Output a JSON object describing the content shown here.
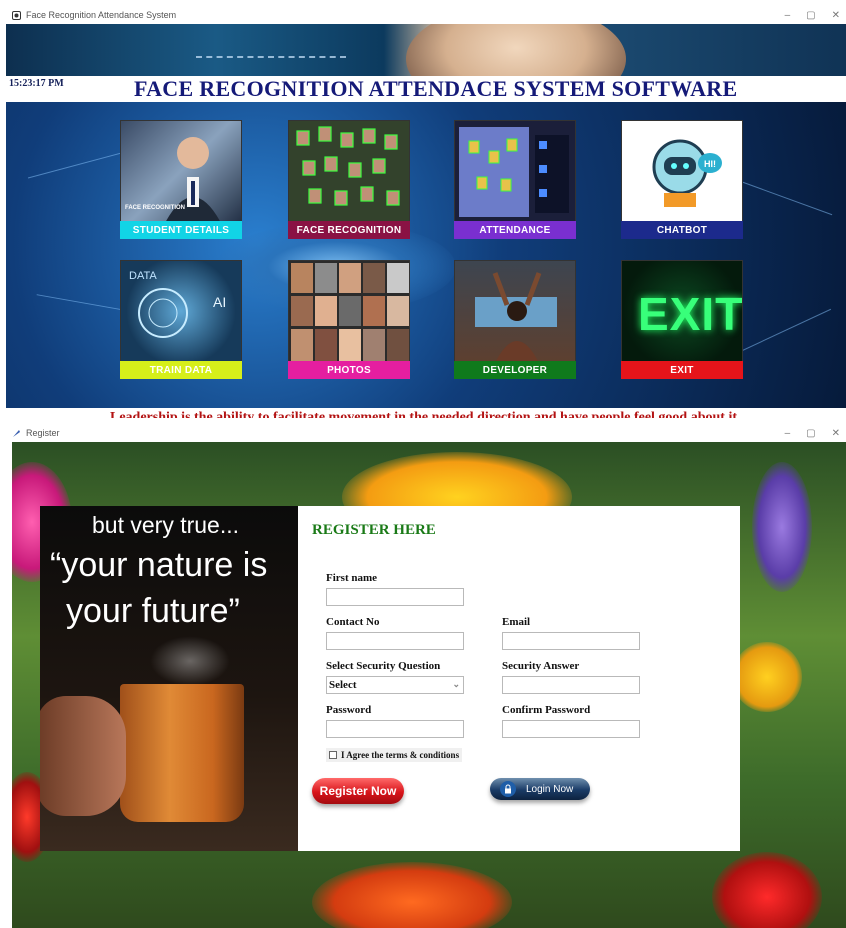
{
  "window1": {
    "title": "Face Recognition Attendance System",
    "clock": "15:23:17 PM",
    "heading": "FACE RECOGNITION ATTENDACE SYSTEM SOFTWARE",
    "tiles": [
      {
        "label": "STUDENT DETAILS",
        "color": "#11d4e6",
        "icon": "student-photo"
      },
      {
        "label": "FACE RECOGNITION",
        "color": "#8a1244",
        "icon": "faces-grid"
      },
      {
        "label": "ATTENDANCE",
        "color": "#7a2fd0",
        "icon": "attendance-screen"
      },
      {
        "label": "CHATBOT",
        "color": "#1c2a8c",
        "icon": "robot"
      },
      {
        "label": "TRAIN DATA",
        "color": "#d6ef1a",
        "icon": "data-globe"
      },
      {
        "label": "PHOTOS",
        "color": "#e51ea0",
        "icon": "photo-collage"
      },
      {
        "label": "DEVELOPER",
        "color": "#0f7a1c",
        "icon": "developer-photo"
      },
      {
        "label": "EXIT",
        "color": "#e5141a",
        "icon": "exit-sign"
      }
    ],
    "exit_sign_text": "EXIT",
    "student_tile_caption": "FACE RECOGNITION",
    "quote": "Leadership is the ability to facilitate movement in the needed direction and have people feel good about it"
  },
  "window2": {
    "title": "Register",
    "quote_line1": "but very true...",
    "quote_line2": "“your nature is",
    "quote_line3": "your future”",
    "form": {
      "title": "REGISTER HERE",
      "first_name_label": "First name",
      "first_name_value": "",
      "contact_label": "Contact No",
      "contact_value": "",
      "email_label": "Email",
      "email_value": "",
      "security_q_label": "Select Security Question",
      "security_q_value": "Select",
      "security_a_label": "Security Answer",
      "security_a_value": "",
      "password_label": "Password",
      "password_value": "",
      "confirm_label": "Confirm Password",
      "confirm_value": "",
      "agree_label": "I Agree the terms & conditions",
      "agree_checked": false,
      "register_button": "Register Now",
      "login_button": "Login Now"
    }
  }
}
